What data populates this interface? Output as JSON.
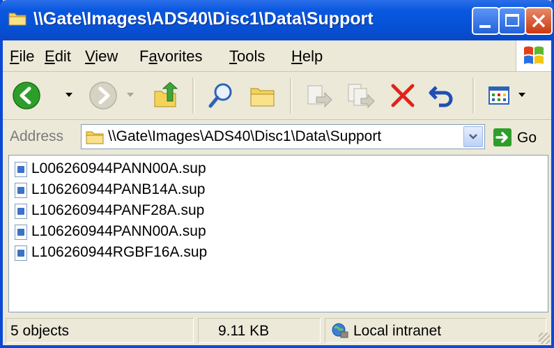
{
  "window": {
    "title": "\\\\Gate\\Images\\ADS40\\Disc1\\Data\\Support"
  },
  "menu": {
    "items": [
      {
        "first": "F",
        "rest": "ile"
      },
      {
        "first": "E",
        "rest": "dit"
      },
      {
        "first": "V",
        "rest": "iew"
      },
      {
        "pre": "F",
        "first": "a",
        "rest": "vorites"
      },
      {
        "first": "T",
        "rest": "ools"
      },
      {
        "first": "H",
        "rest": "elp"
      }
    ]
  },
  "address": {
    "label": "Address",
    "value": "\\\\Gate\\Images\\ADS40\\Disc1\\Data\\Support",
    "go_label": "Go"
  },
  "files": [
    "L006260944PANN00A.sup",
    "L106260944PANB14A.sup",
    "L106260944PANF28A.sup",
    "L106260944PANN00A.sup",
    "L106260944RGBF16A.sup"
  ],
  "status": {
    "objects": "5 objects",
    "size": "9.11 KB",
    "zone": "Local intranet"
  },
  "colors": {
    "titlebar": "#0a58e0",
    "chrome": "#ece9d8",
    "back_green": "#2e9e2a",
    "delete_red": "#e0241b"
  },
  "icons": [
    "back-icon",
    "forward-icon",
    "up-folder-icon",
    "search-icon",
    "folders-icon",
    "move-to-icon",
    "copy-to-icon",
    "delete-icon",
    "undo-icon",
    "views-icon",
    "go-arrow-icon",
    "file-icon",
    "intranet-icon",
    "windows-logo-icon"
  ]
}
